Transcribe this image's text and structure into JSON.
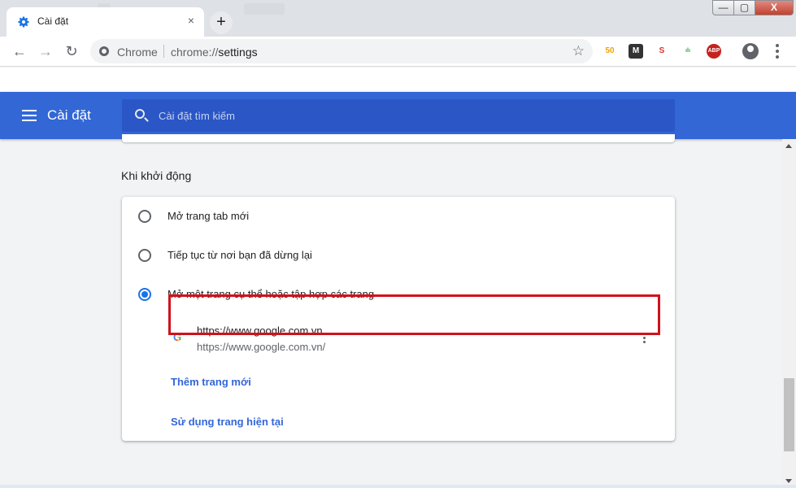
{
  "tab": {
    "title": "Cài đặt",
    "close": "×",
    "new_tab": "+"
  },
  "window_controls": {
    "minimize": "—",
    "maximize": "▢",
    "close": "X"
  },
  "omnibox": {
    "site": "Chrome",
    "url_scheme": "chrome://",
    "url_path": "settings"
  },
  "extensions": [
    {
      "name": "extension-50",
      "label": "50",
      "color": "#f4a100"
    },
    {
      "name": "extension-m",
      "label": "M",
      "color": "#333333"
    },
    {
      "name": "extension-seo",
      "label": "S",
      "color": "#d93025"
    },
    {
      "name": "extension-chart",
      "label": "ılı",
      "color": "#34a853"
    },
    {
      "name": "extension-abp",
      "label": "ABP",
      "color": "#c5221f"
    }
  ],
  "header": {
    "title": "Cài đặt",
    "search_placeholder": "Cài đặt tìm kiếm"
  },
  "startup": {
    "section_title": "Khi khởi động",
    "options": [
      {
        "label": "Mở trang tab mới",
        "checked": false
      },
      {
        "label": "Tiếp tục từ nơi bạn đã dừng lại",
        "checked": false
      },
      {
        "label": "Mở một trang cụ thể hoặc tập hợp các trang",
        "checked": true
      }
    ],
    "pages": [
      {
        "title": "https://www.google.com.vn",
        "url": "https://www.google.com.vn/",
        "icon": "G"
      }
    ],
    "add_page": "Thêm trang mới",
    "use_current": "Sử dụng trang hiện tại"
  },
  "colors": {
    "accent": "#3367d6",
    "highlight": "#d0121b",
    "radio_checked": "#1a73e8"
  }
}
